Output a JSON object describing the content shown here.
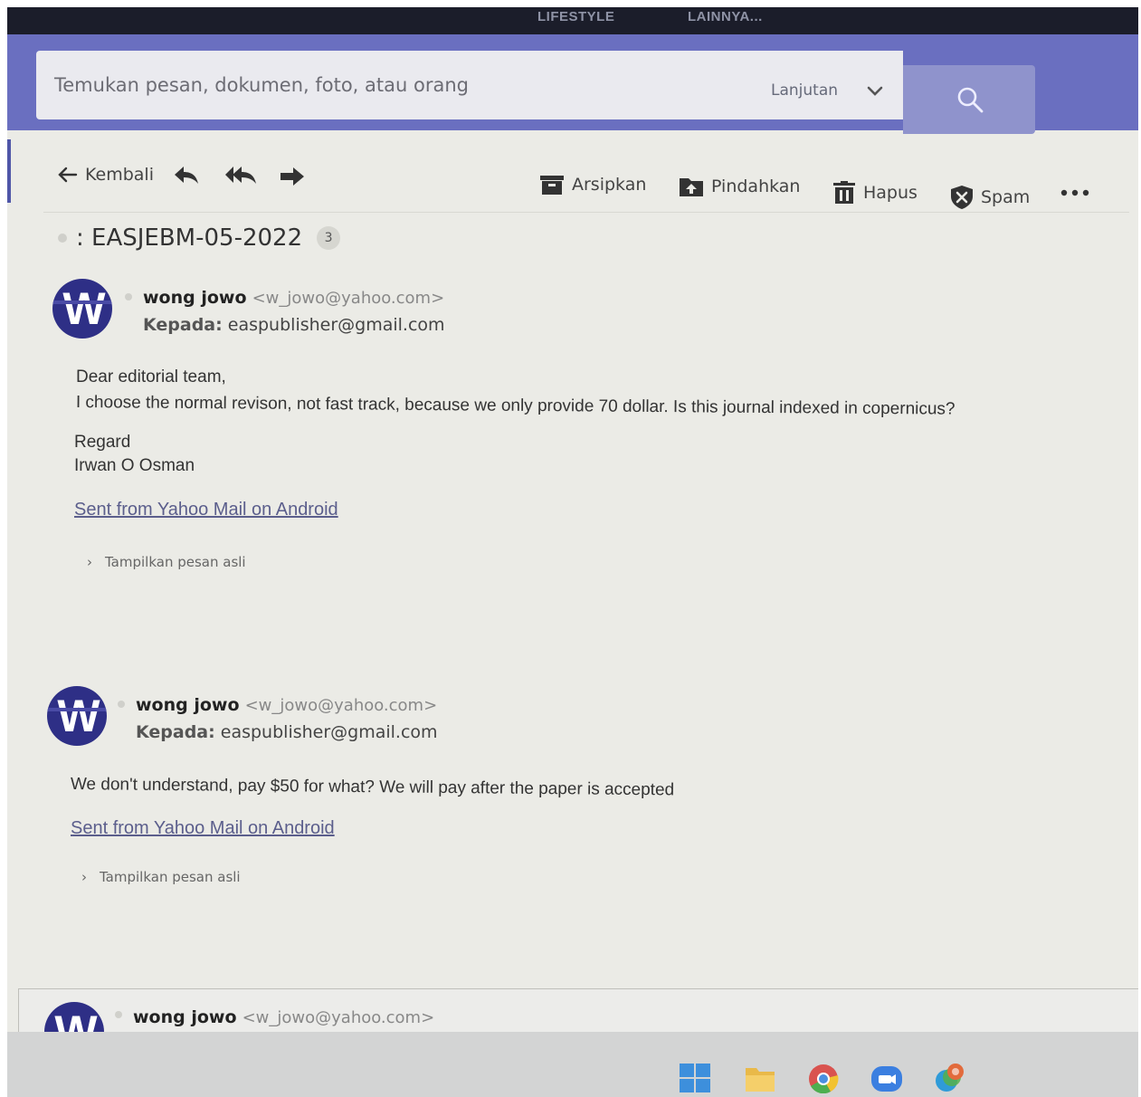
{
  "topnav": {
    "items": [
      "LIFESTYLE",
      "LAINNYA..."
    ]
  },
  "search": {
    "placeholder": "Temukan pesan, dokumen, foto, atau orang",
    "advanced_label": "Lanjutan",
    "icon": "search-icon"
  },
  "toolbar": {
    "back_label": "Kembali",
    "archive_label": "Arsipkan",
    "move_label": "Pindahkan",
    "delete_label": "Hapus",
    "spam_label": "Spam",
    "more_icon": "more-icon"
  },
  "thread": {
    "subject": ": EASJEBM-05-2022",
    "count": "3"
  },
  "messages": [
    {
      "avatar_letter": "W",
      "sender_name": "wong jowo",
      "sender_email": "<w_jowo@yahoo.com>",
      "to_label": "Kepada:",
      "to": "easpublisher@gmail.com",
      "body": [
        "Dear editorial team,",
        "I choose the normal revison, not fast track, because we only provide 70 dollar. Is this journal indexed in copernicus?",
        "Regard",
        "Irwan O Osman"
      ],
      "signature": "Sent from Yahoo Mail on Android",
      "show_original": "Tampilkan pesan asli"
    },
    {
      "avatar_letter": "W",
      "sender_name": "wong jowo",
      "sender_email": "<w_jowo@yahoo.com>",
      "to_label": "Kepada:",
      "to": "easpublisher@gmail.com",
      "body": [
        "We don't understand, pay $50 for what? We will pay after the paper is accepted"
      ],
      "signature": "Sent from Yahoo Mail on Android",
      "show_original": "Tampilkan pesan asli"
    },
    {
      "avatar_letter": "W",
      "sender_name": "wong jowo",
      "sender_email": "<w_jowo@yahoo.com>"
    }
  ],
  "colors": {
    "nav_bg": "#1b1d2a",
    "search_band": "#6a6fc0",
    "avatar": "#2e2f86",
    "link": "#5b5e8c"
  }
}
